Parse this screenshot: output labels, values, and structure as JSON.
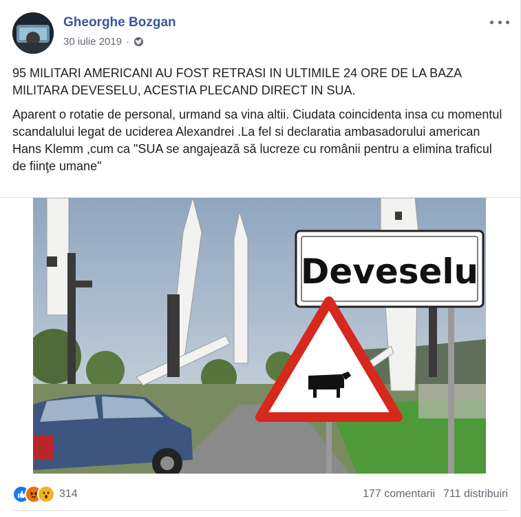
{
  "post": {
    "author": "Gheorghe Bozgan",
    "date": "30 iulie 2019",
    "separator": "·",
    "privacy_icon": "globe-icon",
    "more_icon": "more-options-icon",
    "paragraphs": [
      "95 MILITARI AMERICANI AU FOST RETRASI IN ULTIMILE 24 ORE DE LA BAZA MILITARA DEVESELU, ACESTIA PLECAND DIRECT IN SUA.",
      "Aparent o rotatie de personal, urmand sa vina altii. Ciudata coincidenta insa cu momentul scandalului legat de uciderea Alexandrei .La fel si declaratia ambasadorului american Hans Klemm ,cum ca \"SUA se angajează să lucreze cu românii pentru a elimina traficul de fiinţe umane\""
    ],
    "image": {
      "sign_text": "Deveselu"
    }
  },
  "footer": {
    "reactions": [
      "like-icon",
      "angry-icon",
      "wow-icon"
    ],
    "reaction_count": "314",
    "comments": "177 comentarii",
    "shares": "711 distribuiri"
  },
  "colors": {
    "author": "#385898",
    "meta": "#616770",
    "like": "#1877f2",
    "angry": "#e9710f",
    "wow": "#f7b125"
  }
}
